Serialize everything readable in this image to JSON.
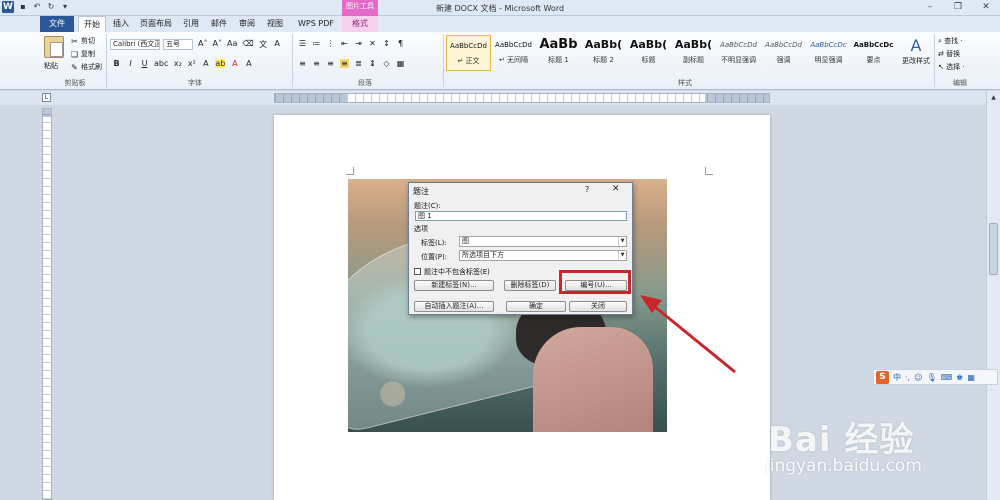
{
  "window": {
    "title": "新建 DOCX 文档 - Microsoft Word",
    "context_tab_group": "图片工具"
  },
  "tabs": [
    "文件",
    "开始",
    "插入",
    "页面布局",
    "引用",
    "邮件",
    "审阅",
    "视图",
    "WPS PDF",
    "格式"
  ],
  "ribbon": {
    "clipboard": {
      "paste": "粘贴",
      "cut": "剪切",
      "copy": "复制",
      "format_painter": "格式刷",
      "label": "剪贴板"
    },
    "font": {
      "font_name": "Calibri (西文正",
      "font_size": "五号",
      "label": "字体"
    },
    "paragraph": {
      "label": "段落"
    },
    "styles": {
      "label": "样式",
      "items": [
        {
          "sample": "AaBbCcDd",
          "name": "↵ 正文"
        },
        {
          "sample": "AaBbCcDd",
          "name": "↵ 无间隔"
        },
        {
          "sample": "AaBb",
          "name": "标题 1"
        },
        {
          "sample": "AaBb(",
          "name": "标题 2"
        },
        {
          "sample": "AaBb(",
          "name": "标题"
        },
        {
          "sample": "AaBb(",
          "name": "副标题"
        },
        {
          "sample": "AaBbCcDd",
          "name": "不明显强调"
        },
        {
          "sample": "AaBbCcDd",
          "name": "强调"
        },
        {
          "sample": "AaBbCcDc",
          "name": "明显强调"
        },
        {
          "sample": "AaBbCcDc",
          "name": "要点"
        }
      ],
      "change_styles": "更改样式"
    },
    "editing": {
      "find": "查找 ·",
      "replace": "替换",
      "select": "选择 ·",
      "label": "编辑"
    }
  },
  "dialog": {
    "title": "题注",
    "help": "?",
    "close": "✕",
    "caption_label": "题注(C):",
    "caption_value": "图 1",
    "options_label": "选项",
    "label_label": "标签(L):",
    "label_value": "图",
    "position_label": "位置(P):",
    "position_value": "所选项目下方",
    "exclude_label": "题注中不包含标签(E)",
    "new_label_button": "新建标签(N)...",
    "delete_label_button": "删除标签(D)",
    "numbering_button": "编号(U)...",
    "autocaption_button": "自动插入题注(A)...",
    "ok_button": "确定",
    "close_button": "关闭"
  },
  "ime": {
    "logo": "S",
    "mode": "中"
  },
  "watermark": {
    "main": "Bai 经验",
    "url": "jingyan.baidu.com"
  },
  "colors": {
    "file_tab": "#2b579a",
    "context_tab": "#e36ac6",
    "highlight": "#c9262c"
  }
}
